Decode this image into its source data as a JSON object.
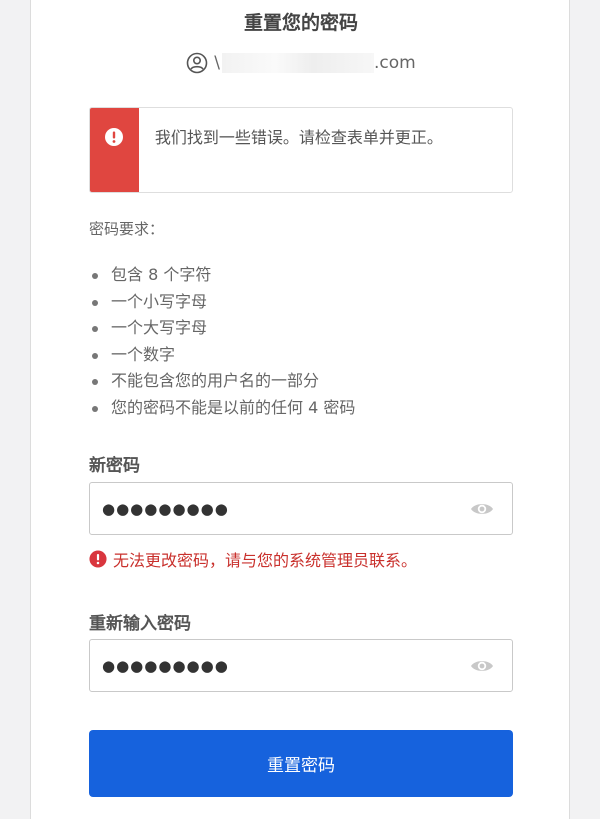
{
  "page": {
    "title": "重置您的密码"
  },
  "identifier": {
    "icon": "user-circle-icon",
    "prefix": "\\",
    "suffix": ".com"
  },
  "error_box": {
    "icon": "exclamation-circle-icon",
    "message": "我们找到一些错误。请检查表单并更正。",
    "bar_color": "#e04640"
  },
  "requirements": {
    "title": "密码要求：",
    "items": [
      "包含 8 个字符",
      "一个小写字母",
      "一个大写字母",
      "一个数字",
      "不能包含您的用户名的一部分",
      "您的密码不能是以前的任何 4 密码"
    ]
  },
  "new_password": {
    "label": "新密码",
    "value_display": "●●●●●●●●●",
    "toggle_icon": "eye-icon",
    "error": "无法更改密码，请与您的系统管理员联系。",
    "error_color": "#c9302c"
  },
  "confirm_password": {
    "label": "重新输入密码",
    "value_display": "●●●●●●●●●",
    "toggle_icon": "eye-icon"
  },
  "submit": {
    "label": "重置密码",
    "color": "#1662dd"
  }
}
